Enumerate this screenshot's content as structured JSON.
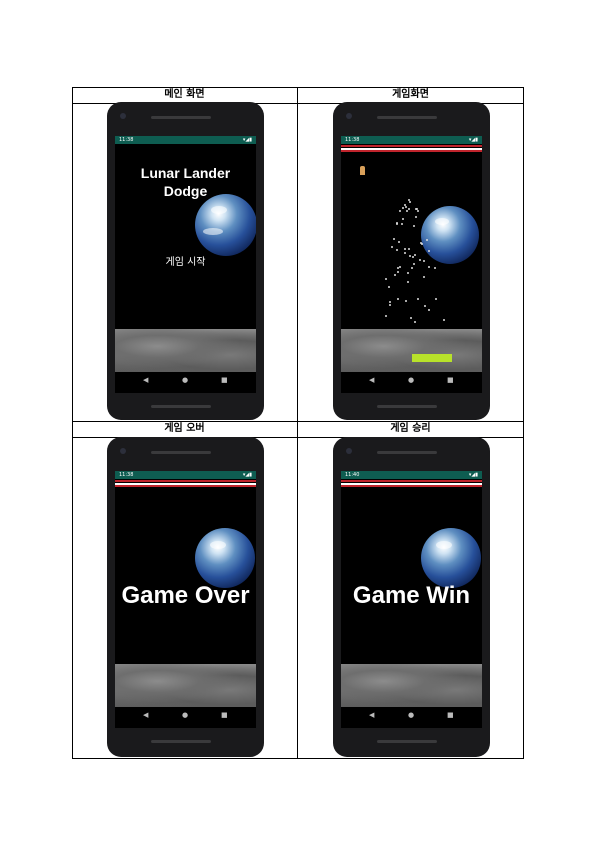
{
  "headers": [
    "메인 화면",
    "게임화면",
    "게임 오버",
    "게임 승리"
  ],
  "screens": {
    "main": {
      "time": "11:38",
      "status_icons": "▾◢▮",
      "title_line1": "Lunar Lander",
      "title_line2": "Dodge",
      "start_button": "게임 시작",
      "nav": [
        "◀",
        "●",
        "■"
      ]
    },
    "game": {
      "time": "11:38",
      "status_icons": "▾◢▮",
      "nav": [
        "◀",
        "●",
        "■"
      ]
    },
    "over": {
      "time": "11:38",
      "status_icons": "▾◢▮",
      "message": "Game Over",
      "nav": [
        "◀",
        "●",
        "■"
      ]
    },
    "win": {
      "time": "11:40",
      "status_icons": "▾◢▮",
      "message": "Game Win",
      "nav": [
        "◀",
        "●",
        "■"
      ]
    }
  },
  "colors": {
    "status_bar": "#0e5d51",
    "accent_red": "#c0242c",
    "player_bar": "#b8e22a"
  }
}
